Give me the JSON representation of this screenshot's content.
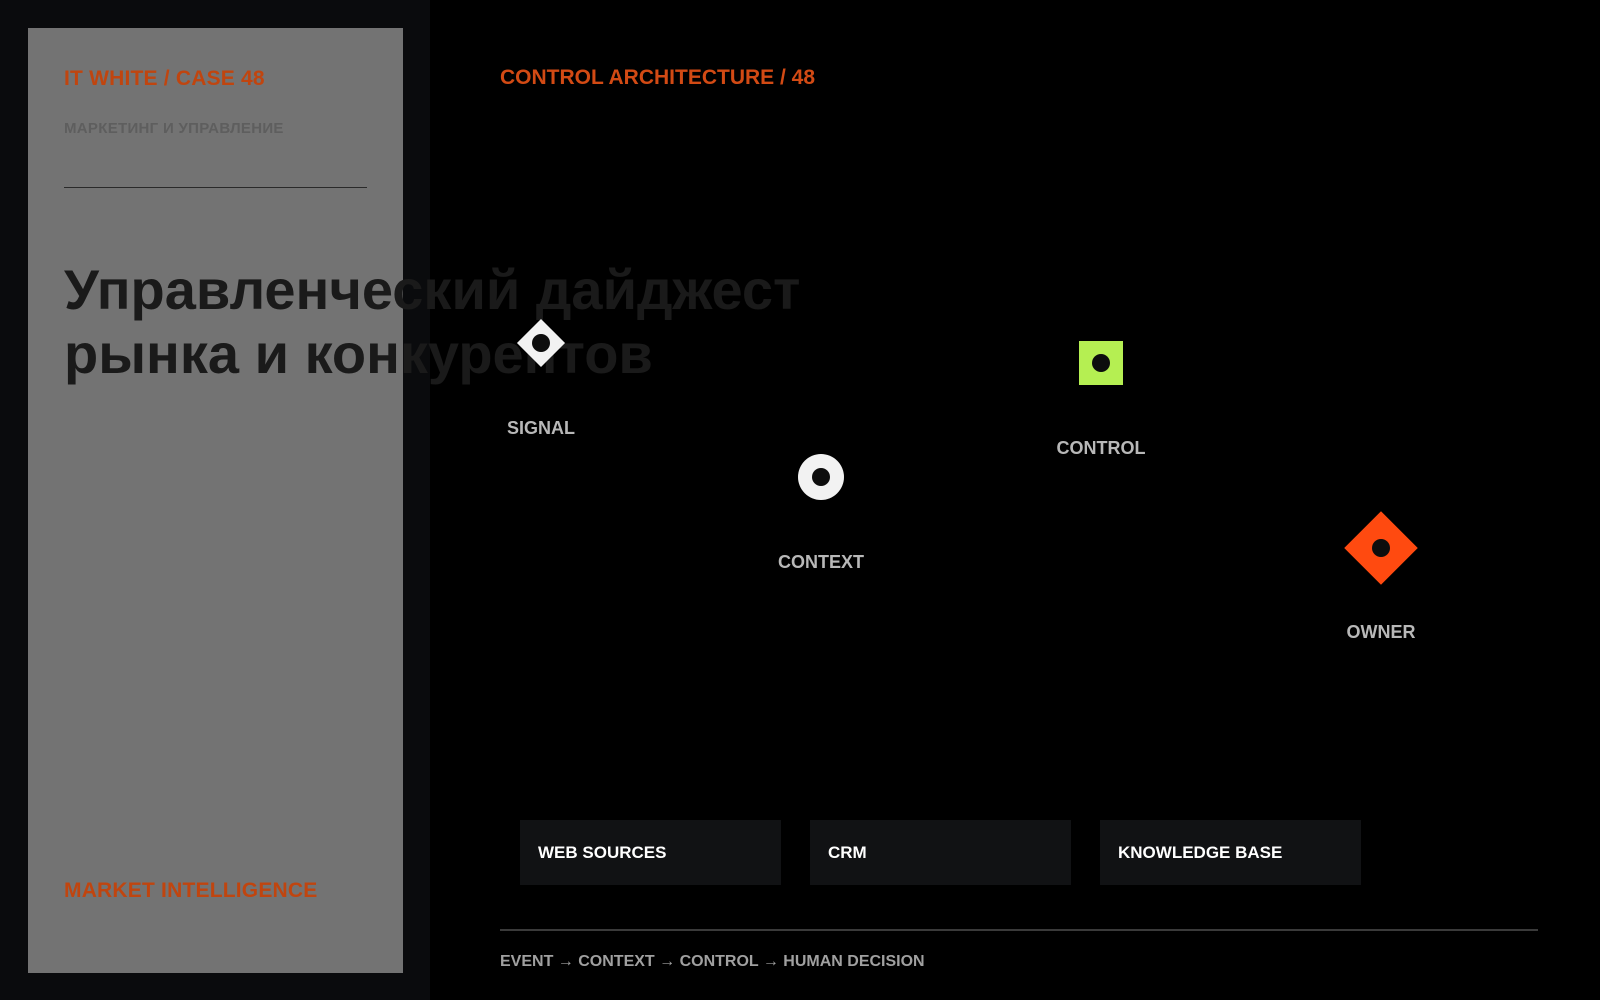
{
  "card": {
    "title": "IT WHITE / CASE 48",
    "subtitle": "МАРКЕТИНГ И УПРАВЛЕНИЕ",
    "headline_line1": "Управленческий дайджест",
    "headline_line2": "рынка и конкурентов",
    "footer": "MARKET INTELLIGENCE"
  },
  "diagram": {
    "title": "CONTROL ARCHITECTURE / 48",
    "nodes": [
      {
        "label": "SIGNAL",
        "shape": "diamond",
        "color": "#f2f2f2",
        "icon": "diamond-node-icon"
      },
      {
        "label": "CONTEXT",
        "shape": "circle",
        "color": "#f2f2f2",
        "icon": "circle-node-icon"
      },
      {
        "label": "CONTROL",
        "shape": "square",
        "color": "#b5ef52",
        "icon": "square-node-icon"
      },
      {
        "label": "OWNER",
        "shape": "diamond",
        "color": "#ff4a10",
        "icon": "diamond-node-icon"
      }
    ],
    "sources": [
      "WEB SOURCES",
      "CRM",
      "KNOWLEDGE BASE"
    ],
    "flow": "EVENT → CONTEXT → CONTROL → HUMAN DECISION"
  },
  "colors": {
    "accent": "#c0450f",
    "signal": "#f2f2f2",
    "control": "#b5ef52",
    "owner": "#ff4a10"
  }
}
